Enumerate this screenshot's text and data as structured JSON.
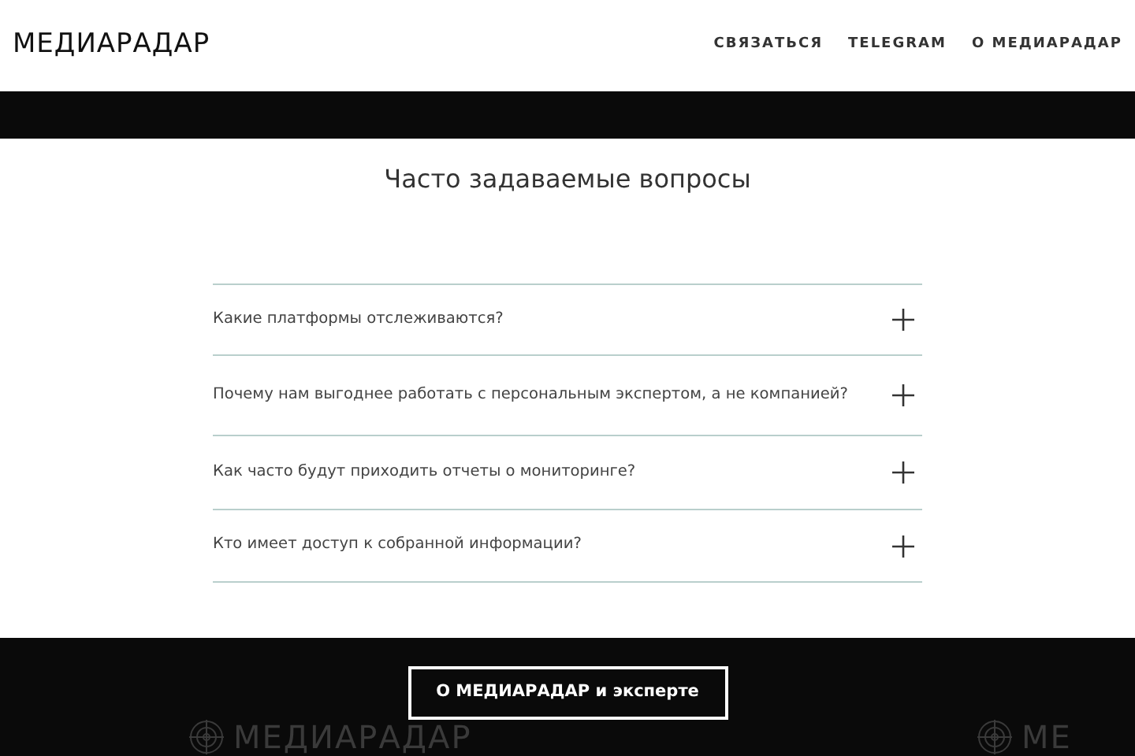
{
  "header": {
    "logo": "МЕДИАРАДАР",
    "nav": [
      {
        "label": "СВЯЗАТЬСЯ"
      },
      {
        "label": "TELEGRAM"
      },
      {
        "label": "О МЕДИАРАДАР"
      }
    ]
  },
  "faq": {
    "title": "Часто задаваемые вопросы",
    "items": [
      {
        "question": "Какие платформы отслеживаются?",
        "expanded": false
      },
      {
        "question": "Почему нам выгоднее работать с персональным экспертом, а не компанией?",
        "expanded": false
      },
      {
        "question": "Как часто будут приходить отчеты о мониторинге?",
        "expanded": false
      },
      {
        "question": "Кто имеет доступ к собранной информации?",
        "expanded": false
      }
    ]
  },
  "footer": {
    "button": "О МЕДИАРАДАР и эксперте",
    "logos": [
      {
        "text": "МЕДИАРАДАР"
      },
      {
        "text": "МЕ"
      }
    ]
  }
}
